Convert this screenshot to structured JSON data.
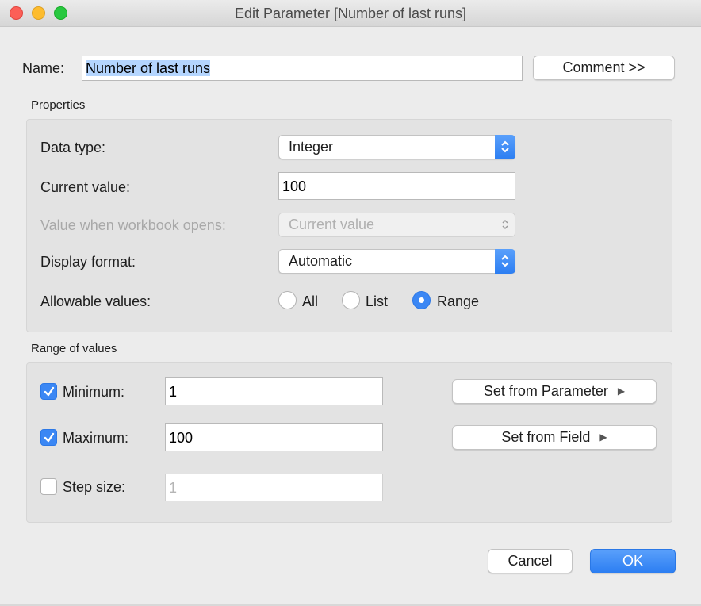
{
  "window": {
    "title": "Edit Parameter [Number of last runs]"
  },
  "name_row": {
    "label": "Name:",
    "value": "Number of last runs",
    "comment_button": "Comment >>"
  },
  "properties": {
    "section_label": "Properties",
    "data_type": {
      "label": "Data type:",
      "value": "Integer"
    },
    "current_value": {
      "label": "Current value:",
      "value": "100"
    },
    "workbook_opens": {
      "label": "Value when workbook opens:",
      "value": "Current value",
      "disabled": true
    },
    "display_format": {
      "label": "Display format:",
      "value": "Automatic"
    },
    "allowable_values": {
      "label": "Allowable values:",
      "options": [
        "All",
        "List",
        "Range"
      ],
      "selected": "Range"
    }
  },
  "range": {
    "section_label": "Range of values",
    "minimum": {
      "label": "Minimum:",
      "value": "1",
      "checked": true
    },
    "maximum": {
      "label": "Maximum:",
      "value": "100",
      "checked": true
    },
    "step_size": {
      "label": "Step size:",
      "value": "1",
      "checked": false
    },
    "set_from_parameter": "Set from Parameter",
    "set_from_field": "Set from Field"
  },
  "footer": {
    "cancel": "Cancel",
    "ok": "OK"
  },
  "colors": {
    "accent": "#3b87f4",
    "selection": "#b4d5fe"
  },
  "icons": [
    "close-icon",
    "minimize-icon",
    "zoom-icon",
    "chevron-updown-icon",
    "checkmark-icon",
    "play-arrow-icon"
  ]
}
